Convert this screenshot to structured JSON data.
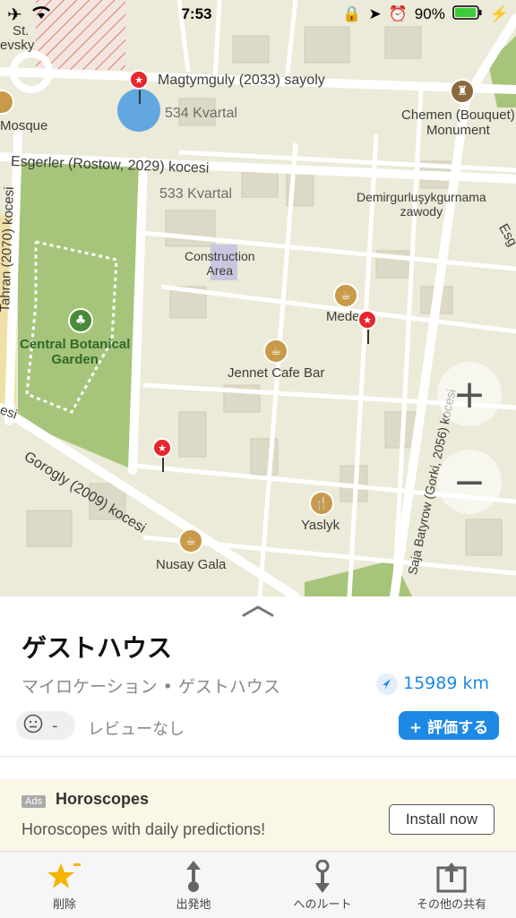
{
  "status": {
    "time": "7:53",
    "battery": "90%"
  },
  "map": {
    "labels": {
      "st": "St.",
      "evsky": "evsky",
      "mosque": "Mosque",
      "magtymguly": "Magtymguly (2033) sayoly",
      "kvartal534": "534 Kvartal",
      "chemen": "Chemen (Bouquet)\nMonument",
      "esgerler": "Esgerler (Rostow, 2029) kocesi",
      "kvartal533": "533 Kvartal",
      "demir": "Demirgurluşykgurnama\nzawody",
      "esg": "Esg",
      "tahran": "Tahran (2070) kocesi",
      "construction": "Construction\nArea",
      "mede": "Mede",
      "botanical": "Central Botanical\nGarden",
      "jennet": "Jennet Cafe Bar",
      "esi": "esi",
      "gorogly": "Gorogly (2009) kocesi",
      "saja": "Saja Batyrow (Gorki, 2056) kocesi",
      "yaslyk": "Yaslyk",
      "nusay": "Nusay Gala"
    },
    "zoom_in": "+",
    "zoom_out": "−"
  },
  "place": {
    "title": "ゲストハウス",
    "subtitle": "マイロケーション • ゲストハウス",
    "distance": "15989 km",
    "rating_dash": "-",
    "review_text": "レビューなし",
    "rate_button": "+ 評価する"
  },
  "ad": {
    "badge": "Ads",
    "title": "Horoscopes",
    "text": "Horoscopes with daily predictions!",
    "button": "Install now"
  },
  "tabs": [
    {
      "label": "削除",
      "icon": "star-icon"
    },
    {
      "label": "出発地",
      "icon": "route-from-icon"
    },
    {
      "label": "へのルート",
      "icon": "route-to-icon"
    },
    {
      "label": "その他の共有",
      "icon": "share-icon"
    }
  ],
  "colors": {
    "accent": "#1e88e5",
    "map_bg": "#ecead8",
    "park": "#a6c57a",
    "pin": "#e8262d",
    "poi": "#c89a4a"
  }
}
